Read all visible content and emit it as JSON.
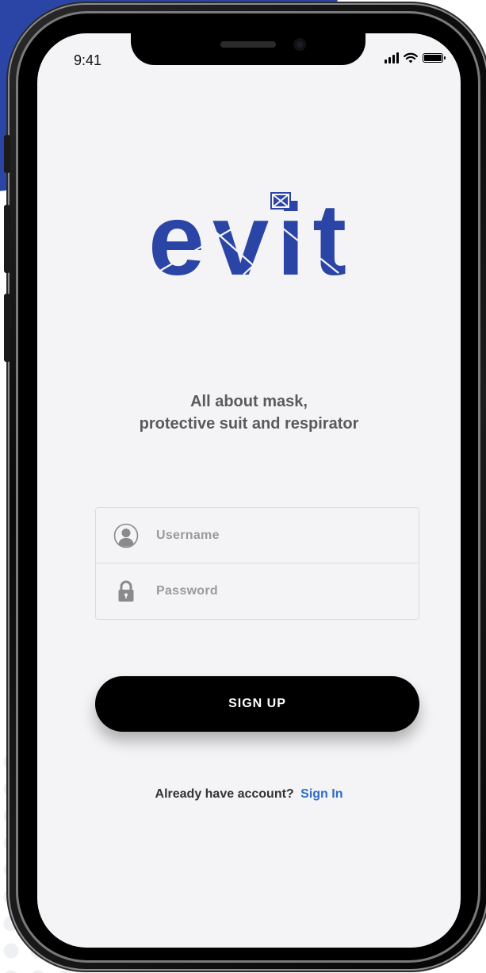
{
  "status_bar": {
    "time": "9:41",
    "icons": [
      "signal-icon",
      "wifi-icon",
      "battery-icon"
    ]
  },
  "logo": {
    "text": "evit",
    "color": "#2b45a6"
  },
  "tagline": {
    "line1": "All about mask,",
    "line2": "protective suit and respirator"
  },
  "form": {
    "username": {
      "placeholder": "Username",
      "value": "",
      "icon": "user-icon"
    },
    "password": {
      "placeholder": "Password",
      "value": "",
      "icon": "lock-icon"
    }
  },
  "signup_button": {
    "label": "SIGN UP"
  },
  "footer": {
    "question": "Already have account?",
    "link_label": "Sign In",
    "link_color": "#2e6cc9"
  },
  "colors": {
    "brand": "#2b45a6",
    "screen_bg": "#f4f4f6",
    "button_bg": "#000000"
  }
}
